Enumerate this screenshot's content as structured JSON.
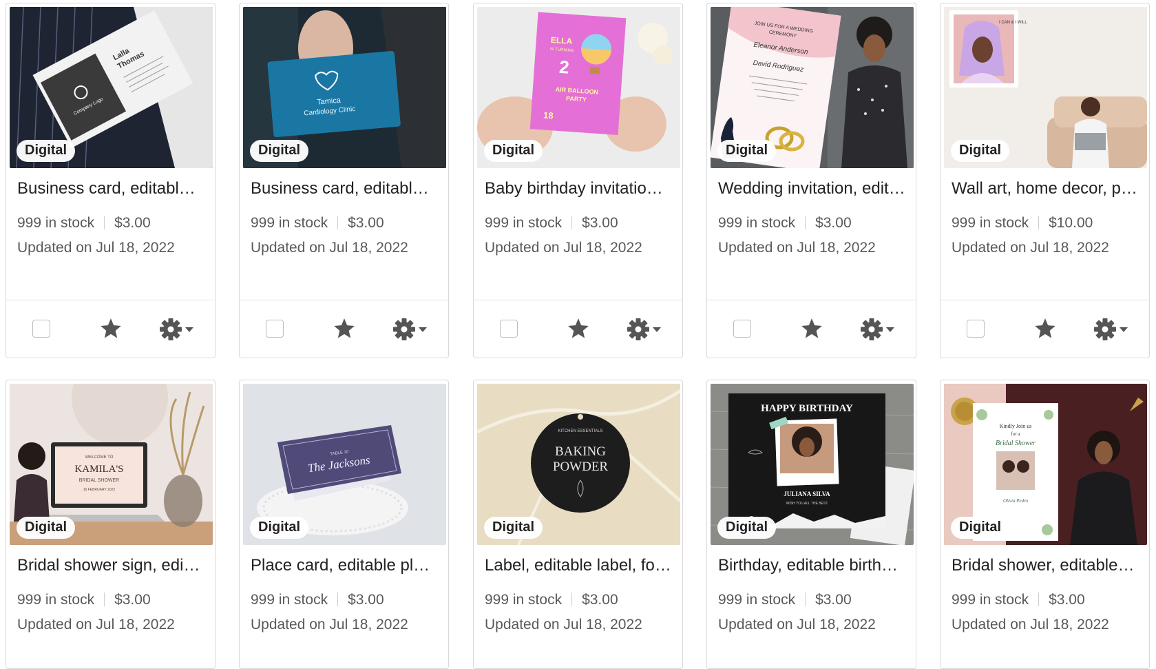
{
  "badge_label": "Digital",
  "colors": {
    "accent_icon": "#555555",
    "muted_text": "#595959",
    "border": "#d9d9d9"
  },
  "icons": {
    "select": "checkbox-icon",
    "favorite": "star-icon",
    "settings": "gear-icon",
    "menu": "chevron-down-icon"
  },
  "listings": [
    {
      "title": "Business card, editable business card, editable template",
      "stock": "999 in stock",
      "price": "$3.00",
      "updated": "Updated on Jul 18, 2022"
    },
    {
      "title": "Business card, editable business card, editable template",
      "stock": "999 in stock",
      "price": "$3.00",
      "updated": "Updated on Jul 18, 2022"
    },
    {
      "title": "Baby birthday invitation, editable invitation",
      "stock": "999 in stock",
      "price": "$3.00",
      "updated": "Updated on Jul 18, 2022"
    },
    {
      "title": "Wedding invitation, editable invitation",
      "stock": "999 in stock",
      "price": "$3.00",
      "updated": "Updated on Jul 18, 2022"
    },
    {
      "title": "Wall art, home decor, printable wall art",
      "stock": "999 in stock",
      "price": "$10.00",
      "updated": "Updated on Jul 18, 2022"
    },
    {
      "title": "Bridal shower sign, editable sign",
      "stock": "999 in stock",
      "price": "$3.00",
      "updated": "Updated on Jul 18, 2022"
    },
    {
      "title": "Place card, editable place card",
      "stock": "999 in stock",
      "price": "$3.00",
      "updated": "Updated on Jul 18, 2022"
    },
    {
      "title": "Label, editable label, food label",
      "stock": "999 in stock",
      "price": "$3.00",
      "updated": "Updated on Jul 18, 2022"
    },
    {
      "title": "Birthday, editable birthday card",
      "stock": "999 in stock",
      "price": "$3.00",
      "updated": "Updated on Jul 18, 2022"
    },
    {
      "title": "Bridal shower, editable invitation",
      "stock": "999 in stock",
      "price": "$3.00",
      "updated": "Updated on Jul 18, 2022"
    }
  ],
  "thumb_text": {
    "t0": [
      "Lalla",
      "Thomas",
      "Company Logo"
    ],
    "t1": [
      "Tamica",
      "Cardiology Clinic"
    ],
    "t2": [
      "ELLA",
      "IS TURNING",
      "2",
      "AIR BALLOON",
      "PARTY",
      "18"
    ],
    "t3": [
      "JOIN US FOR A WEDDING",
      "CEREMONY",
      "Eleanor Anderson",
      "David Rodriguez"
    ],
    "t4": [
      "I CAN & I WILL"
    ],
    "t5": [
      "WELCOME TO",
      "KAMILA'S",
      "BRIDAL SHOWER",
      "16 FEBRUARY 2022"
    ],
    "t6": [
      "TABLE 10",
      "The Jacksons"
    ],
    "t7": [
      "KITCHEN ESSENTIALS",
      "BAKING",
      "POWDER"
    ],
    "t8": [
      "HAPPY BIRTHDAY",
      "JULIANA SILVA",
      "WISH YOU ALL THE BEST"
    ],
    "t9": [
      "Kindly Join us",
      "for a",
      "Bridal Shower",
      "Olivia Pedro"
    ]
  }
}
